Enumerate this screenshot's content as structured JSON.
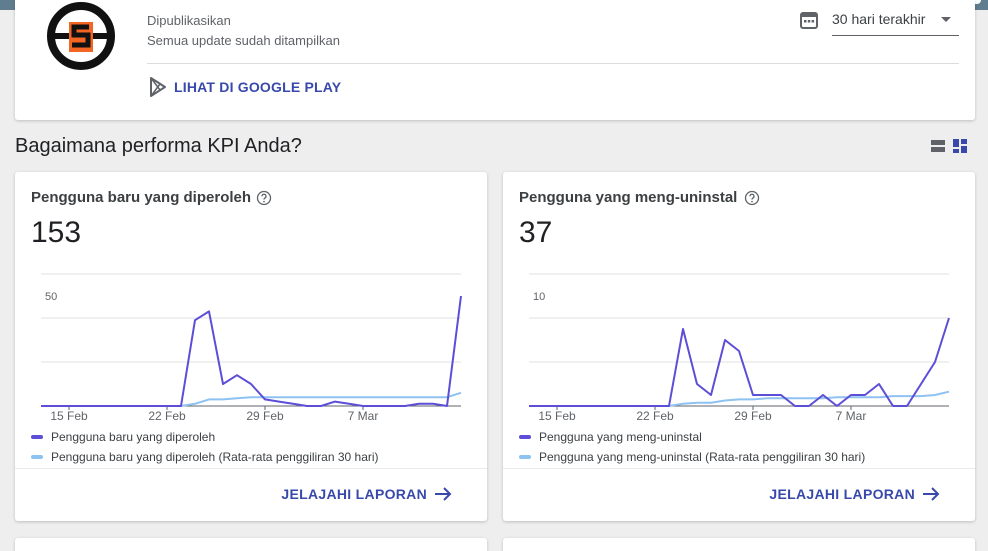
{
  "header": {
    "published_label": "Dipublikasikan",
    "update_status": "Semua update sudah ditampilkan",
    "date_range": {
      "value": "30 hari terakhir",
      "icon": "calendar-icon"
    },
    "play_link_label": "LIHAT DI GOOGLE PLAY",
    "play_icon": "google-play-icon",
    "logo_icon": "app-logo-icon"
  },
  "section": {
    "title": "Bagaimana performa KPI Anda?",
    "view_icons": [
      "list-view-icon",
      "grid-view-icon"
    ]
  },
  "cards": [
    {
      "title": "Pengguna baru yang diperoleh",
      "value": "153",
      "explore_label": "JELAJAHI LAPORAN",
      "legend": [
        "Pengguna baru yang diperoleh",
        "Pengguna baru yang diperoleh (Rata-rata penggiliran 30 hari)"
      ]
    },
    {
      "title": "Pengguna yang meng-uninstal",
      "value": "37",
      "explore_label": "JELAJAHI LAPORAN",
      "legend": [
        "Pengguna yang meng-uninstal",
        "Pengguna yang meng-uninstal (Rata-rata penggiliran 30 hari)"
      ]
    }
  ],
  "colors": {
    "series_primary": "#5c4ed6",
    "series_average": "#8ec2f0",
    "accent_link": "#3949ab",
    "logo_orange": "#f26522"
  },
  "chart_data": [
    {
      "type": "line",
      "x": [
        "13 Feb",
        "14 Feb",
        "15 Feb",
        "16 Feb",
        "17 Feb",
        "18 Feb",
        "19 Feb",
        "20 Feb",
        "21 Feb",
        "22 Feb",
        "23 Feb",
        "24 Feb",
        "25 Feb",
        "26 Feb",
        "27 Feb",
        "28 Feb",
        "29 Feb",
        "1 Mar",
        "2 Mar",
        "3 Mar",
        "4 Mar",
        "5 Mar",
        "6 Mar",
        "7 Mar",
        "8 Mar",
        "9 Mar",
        "10 Mar",
        "11 Mar",
        "12 Mar",
        "13 Mar",
        "14 Mar"
      ],
      "x_ticks": [
        "15 Feb",
        "22 Feb",
        "29 Feb",
        "7 Mar"
      ],
      "ylim": [
        0,
        60
      ],
      "y_ticks": [
        "50"
      ],
      "series": [
        {
          "name": "Pengguna baru yang diperoleh",
          "values": [
            0,
            0,
            0,
            0,
            0,
            0,
            0,
            0,
            0,
            0,
            0,
            39,
            43,
            10,
            14,
            10,
            3,
            2,
            1,
            0,
            0,
            2,
            1,
            0,
            0,
            0,
            0,
            1,
            1,
            0,
            50
          ]
        },
        {
          "name": "Pengguna baru yang diperoleh (Rata-rata penggiliran 30 hari)",
          "values": [
            0,
            0,
            0,
            0,
            0,
            0,
            0,
            0,
            0,
            0,
            0,
            1,
            3,
            3,
            3.5,
            4,
            4,
            4,
            4,
            4,
            4,
            4,
            4,
            4,
            4,
            4,
            4,
            4,
            4,
            4,
            6
          ]
        }
      ]
    },
    {
      "type": "line",
      "x": [
        "13 Feb",
        "14 Feb",
        "15 Feb",
        "16 Feb",
        "17 Feb",
        "18 Feb",
        "19 Feb",
        "20 Feb",
        "21 Feb",
        "22 Feb",
        "23 Feb",
        "24 Feb",
        "25 Feb",
        "26 Feb",
        "27 Feb",
        "28 Feb",
        "29 Feb",
        "1 Mar",
        "2 Mar",
        "3 Mar",
        "4 Mar",
        "5 Mar",
        "6 Mar",
        "7 Mar",
        "8 Mar",
        "9 Mar",
        "10 Mar",
        "11 Mar",
        "12 Mar",
        "13 Mar",
        "14 Mar"
      ],
      "x_ticks": [
        "15 Feb",
        "22 Feb",
        "29 Feb",
        "7 Mar"
      ],
      "ylim": [
        0,
        12
      ],
      "y_ticks": [
        "10"
      ],
      "series": [
        {
          "name": "Pengguna yang meng-uninstal",
          "values": [
            0,
            0,
            0,
            0,
            0,
            0,
            0,
            0,
            0,
            0,
            0,
            7,
            2,
            1,
            6,
            5,
            1,
            1,
            1,
            0,
            0,
            1,
            0,
            1,
            1,
            2,
            0,
            0,
            2,
            4,
            8
          ]
        },
        {
          "name": "Pengguna yang meng-uninstal (Rata-rata penggiliran 30 hari)",
          "values": [
            0,
            0,
            0,
            0,
            0,
            0,
            0,
            0,
            0,
            0,
            0,
            0.2,
            0.3,
            0.3,
            0.5,
            0.6,
            0.6,
            0.7,
            0.7,
            0.7,
            0.7,
            0.7,
            0.8,
            0.8,
            0.8,
            0.8,
            0.9,
            0.9,
            0.9,
            1,
            1.3
          ]
        }
      ]
    }
  ]
}
